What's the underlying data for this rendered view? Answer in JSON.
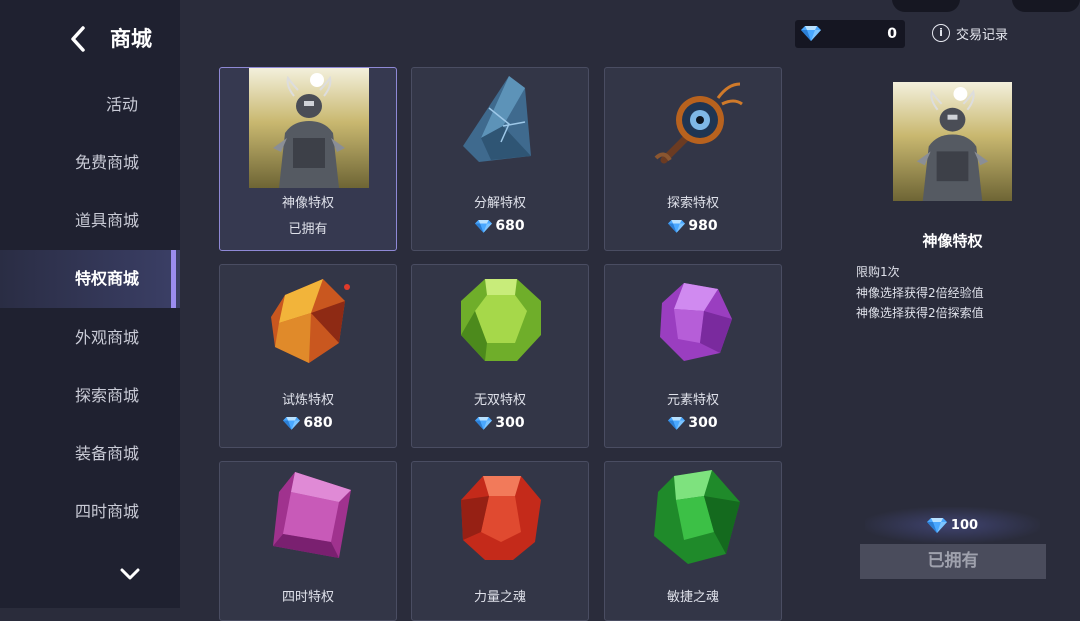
{
  "header": {
    "title": "商城"
  },
  "sidebar": {
    "items": [
      {
        "label": "活动"
      },
      {
        "label": "免费商城"
      },
      {
        "label": "道具商城"
      },
      {
        "label": "特权商城",
        "active": true
      },
      {
        "label": "外观商城"
      },
      {
        "label": "探索商城"
      },
      {
        "label": "装备商城"
      },
      {
        "label": "四时商城"
      }
    ]
  },
  "topbar": {
    "currency_amount": "0",
    "transaction_label": "交易记录"
  },
  "shop": {
    "items": [
      {
        "name": "神像特权",
        "status": "已拥有",
        "icon": "statue-image"
      },
      {
        "name": "分解特权",
        "price": "680",
        "icon": "blue-crystal-shard-icon"
      },
      {
        "name": "探索特权",
        "price": "980",
        "icon": "eye-staff-icon"
      },
      {
        "name": "试炼特权",
        "price": "680",
        "icon": "fire-ore-icon"
      },
      {
        "name": "无双特权",
        "price": "300",
        "icon": "green-gem-icon"
      },
      {
        "name": "元素特权",
        "price": "300",
        "icon": "purple-gem-icon"
      },
      {
        "name": "四时特权",
        "icon": "magenta-gem-icon"
      },
      {
        "name": "力量之魂",
        "icon": "red-gem-icon"
      },
      {
        "name": "敏捷之魂",
        "icon": "emerald-gem-icon"
      }
    ]
  },
  "detail": {
    "title": "神像特权",
    "desc": [
      "限购1次",
      "神像选择获得2倍经验值",
      "神像选择获得2倍探索值"
    ],
    "price": "100",
    "button_label": "已拥有"
  },
  "colors": {
    "accent": "#9b8cf0",
    "gem_blue": "#4aa8ff"
  }
}
